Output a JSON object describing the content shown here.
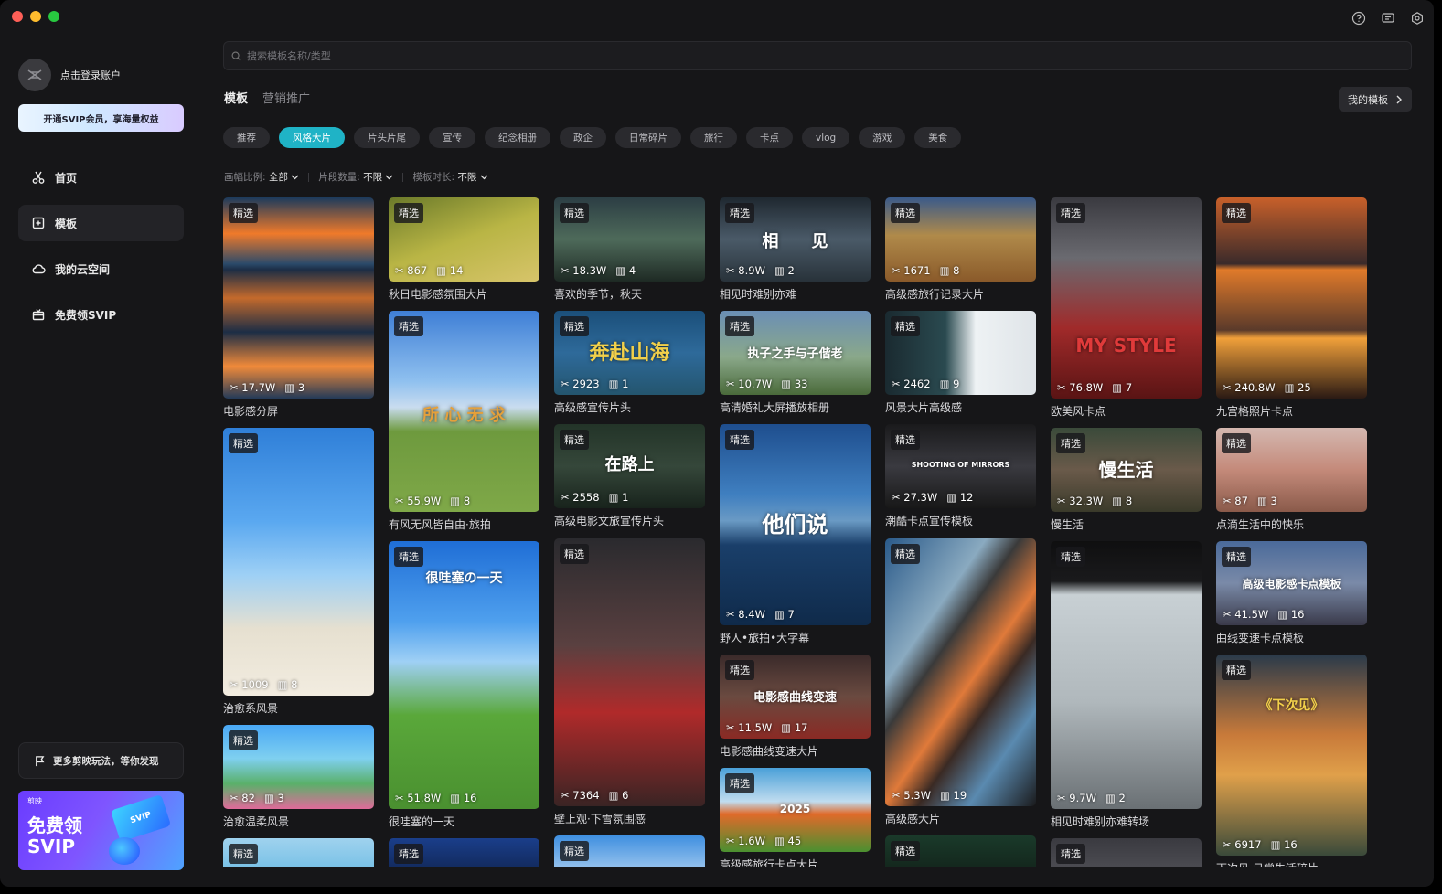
{
  "sidebar": {
    "account_label": "点击登录账户",
    "svip_button": "开通SVIP会员，享海量权益",
    "nav": [
      {
        "label": "首页",
        "icon": "scissors-icon"
      },
      {
        "label": "模板",
        "icon": "template-icon"
      },
      {
        "label": "我的云空间",
        "icon": "cloud-icon"
      },
      {
        "label": "免费领SVIP",
        "icon": "gift-icon"
      }
    ],
    "discover": "更多剪映玩法，等你发现",
    "banner": {
      "logo": "剪映",
      "line1": "免费领",
      "line2": "SVIP",
      "card": "SVIP"
    }
  },
  "search": {
    "placeholder": "搜索模板名称/类型"
  },
  "tabs": [
    "模板",
    "营销推广"
  ],
  "my_templates": "我的模板",
  "chips": [
    "推荐",
    "风格大片",
    "片头片尾",
    "宣传",
    "纪念相册",
    "政企",
    "日常碎片",
    "旅行",
    "卡点",
    "vlog",
    "游戏",
    "美食"
  ],
  "filters": [
    {
      "label": "画幅比例:",
      "value": "全部"
    },
    {
      "label": "片段数量:",
      "value": "不限"
    },
    {
      "label": "模板时长:",
      "value": "不限"
    }
  ],
  "tag_label": "精选",
  "colors": {
    "accent": "#1fb3c6",
    "background": "#161618"
  },
  "cards": [
    {
      "title": "电影感分屏",
      "uses": "17.7W",
      "clips": "3",
      "overlay": ""
    },
    {
      "title": "治愈系风景",
      "uses": "1009",
      "clips": "8",
      "overlay": ""
    },
    {
      "title": "治愈温柔风景",
      "uses": "82",
      "clips": "3",
      "overlay": ""
    },
    {
      "title": "",
      "uses": "",
      "clips": "",
      "overlay": ""
    },
    {
      "title": "秋日电影感氛围大片",
      "uses": "867",
      "clips": "14",
      "overlay": ""
    },
    {
      "title": "有风无风皆自由·旅拍",
      "uses": "55.9W",
      "clips": "8",
      "overlay": "所 心 无 求"
    },
    {
      "title": "很哇塞的一天",
      "uses": "51.8W",
      "clips": "16",
      "overlay": "很哇塞の一天"
    },
    {
      "title": "",
      "uses": "",
      "clips": "",
      "overlay": ""
    },
    {
      "title": "喜欢的季节，秋天",
      "uses": "18.3W",
      "clips": "4",
      "overlay": ""
    },
    {
      "title": "高级感宣传片头",
      "uses": "2923",
      "clips": "1",
      "overlay": "奔赴山海"
    },
    {
      "title": "高级电影文旅宣传片头",
      "uses": "2558",
      "clips": "1",
      "overlay": "在路上"
    },
    {
      "title": "壁上观·下雪氛围感",
      "uses": "7364",
      "clips": "6",
      "overlay": ""
    },
    {
      "title": "",
      "uses": "",
      "clips": "",
      "overlay": ""
    },
    {
      "title": "相见时难别亦难",
      "uses": "8.9W",
      "clips": "2",
      "overlay": "相　　见"
    },
    {
      "title": "高清婚礼大屏播放相册",
      "uses": "10.7W",
      "clips": "33",
      "overlay": "执子之手与子偕老"
    },
    {
      "title": "野人•旅拍•大字幕",
      "uses": "8.4W",
      "clips": "7",
      "overlay": "他们说"
    },
    {
      "title": "电影感曲线变速大片",
      "uses": "11.5W",
      "clips": "17",
      "overlay": "电影感曲线变速"
    },
    {
      "title": "高级感旅行卡点大片",
      "uses": "1.6W",
      "clips": "45",
      "overlay": "2025"
    },
    {
      "title": "高级感旅行记录大片",
      "uses": "1671",
      "clips": "8",
      "overlay": ""
    },
    {
      "title": "风景大片高级感",
      "uses": "2462",
      "clips": "9",
      "overlay": ""
    },
    {
      "title": "潮酷卡点宣传模板",
      "uses": "27.3W",
      "clips": "12",
      "overlay": "SHOOTING OF MIRRORS"
    },
    {
      "title": "高级感大片",
      "uses": "5.3W",
      "clips": "19",
      "overlay": ""
    },
    {
      "title": "",
      "uses": "",
      "clips": "",
      "overlay": ""
    },
    {
      "title": "欧美风卡点",
      "uses": "76.8W",
      "clips": "7",
      "overlay": "MY STYLE"
    },
    {
      "title": "慢生活",
      "uses": "32.3W",
      "clips": "8",
      "overlay": "慢生活"
    },
    {
      "title": "相见时难别亦难转场",
      "uses": "9.7W",
      "clips": "2",
      "overlay": ""
    },
    {
      "title": "",
      "uses": "",
      "clips": "",
      "overlay": ""
    },
    {
      "title": "九宫格照片卡点",
      "uses": "240.8W",
      "clips": "25",
      "overlay": ""
    },
    {
      "title": "点滴生活中的快乐",
      "uses": "87",
      "clips": "3",
      "overlay": ""
    },
    {
      "title": "曲线变速卡点模板",
      "uses": "41.5W",
      "clips": "16",
      "overlay": "高级电影感卡点模板"
    },
    {
      "title": "下次见·日常生活碎片",
      "uses": "6917",
      "clips": "16",
      "overlay": "《下次见》"
    }
  ]
}
